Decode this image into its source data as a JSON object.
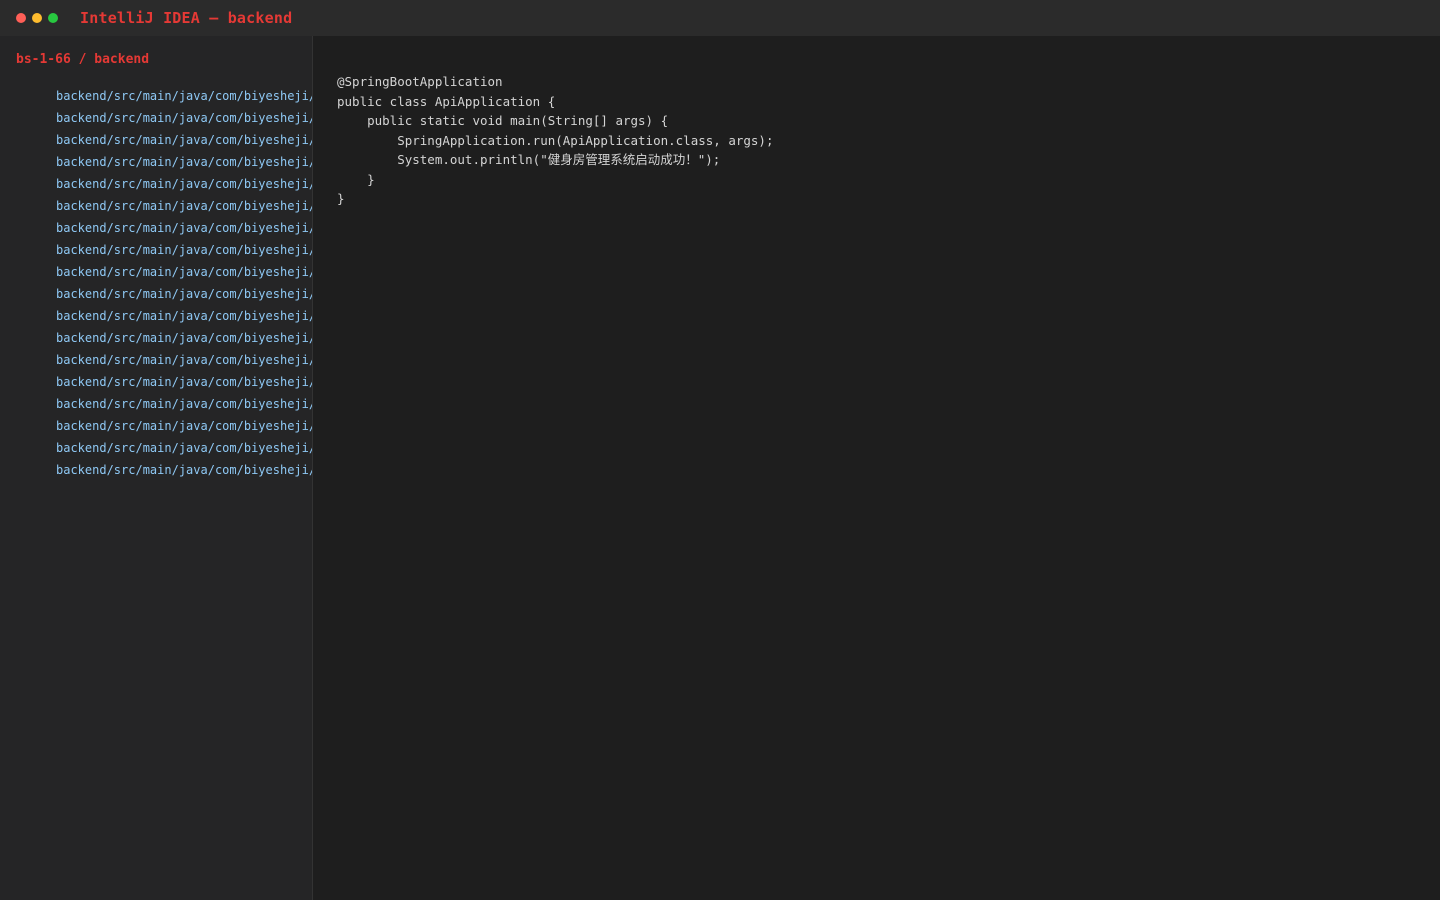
{
  "window": {
    "title": "IntelliJ IDEA — backend"
  },
  "sidebar": {
    "breadcrumb": "bs-1-66 / backend",
    "files": [
      "backend/src/main/java/com/biyesheji/",
      "backend/src/main/java/com/biyesheji/",
      "backend/src/main/java/com/biyesheji/",
      "backend/src/main/java/com/biyesheji/",
      "backend/src/main/java/com/biyesheji/",
      "backend/src/main/java/com/biyesheji/",
      "backend/src/main/java/com/biyesheji/",
      "backend/src/main/java/com/biyesheji/",
      "backend/src/main/java/com/biyesheji/",
      "backend/src/main/java/com/biyesheji/",
      "backend/src/main/java/com/biyesheji/",
      "backend/src/main/java/com/biyesheji/",
      "backend/src/main/java/com/biyesheji/",
      "backend/src/main/java/com/biyesheji/",
      "backend/src/main/java/com/biyesheji/",
      "backend/src/main/java/com/biyesheji/",
      "backend/src/main/java/com/biyesheji/",
      "backend/src/main/java/com/biyesheji/"
    ]
  },
  "editor": {
    "lines": [
      "@SpringBootApplication",
      "public class ApiApplication {",
      "    public static void main(String[] args) {",
      "        SpringApplication.run(ApiApplication.class, args);",
      "        System.out.println(\"健身房管理系统启动成功！\");",
      "    }",
      "}"
    ]
  },
  "colors": {
    "accent": "#e53935",
    "file_link": "#8ec8f4",
    "code_text": "#d4d4d4",
    "background": "#1e1e1e",
    "sidebar_background": "#252526",
    "titlebar_background": "#2b2b2b",
    "close": "#ff5f57",
    "minimize": "#febc2e",
    "maximize": "#28c840"
  },
  "icons": {
    "close": "close-dot-icon",
    "minimize": "minimize-dot-icon",
    "maximize": "maximize-dot-icon"
  }
}
